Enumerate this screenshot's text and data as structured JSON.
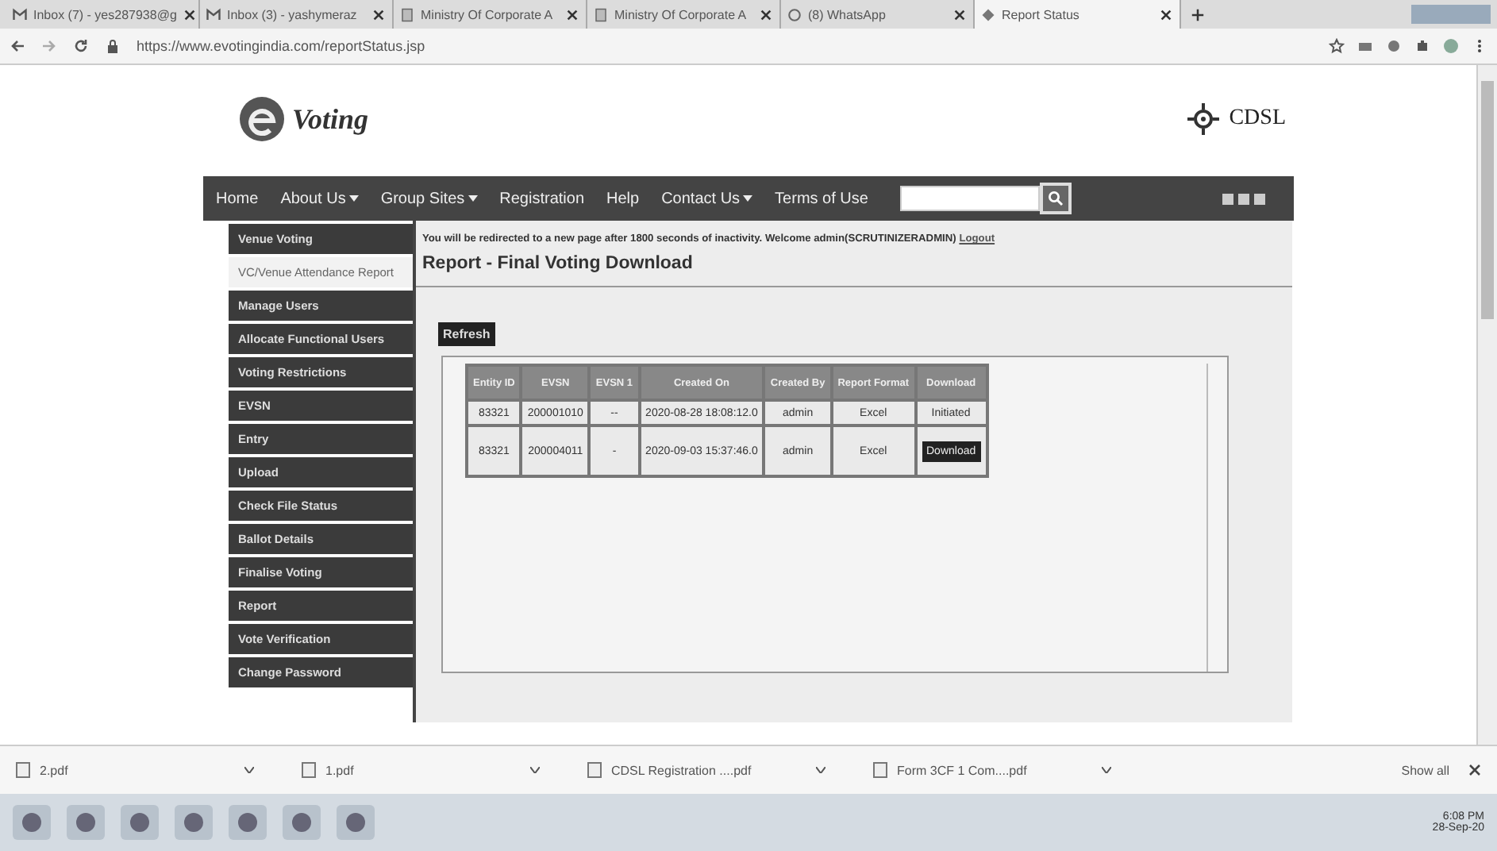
{
  "browser": {
    "tabs": [
      {
        "label": "Inbox (7) - yes287938@g",
        "kind": "mail",
        "selected": false
      },
      {
        "label": "Inbox (3) - yashymeraz",
        "kind": "mail",
        "selected": false
      },
      {
        "label": "Ministry Of Corporate A",
        "kind": "doc",
        "selected": false
      },
      {
        "label": "Ministry Of Corporate A",
        "kind": "doc",
        "selected": false
      },
      {
        "label": "(8) WhatsApp",
        "kind": "chat",
        "selected": false
      },
      {
        "label": "Report Status",
        "kind": "diamond",
        "selected": true
      }
    ],
    "url": "https://www.evotingindia.com/reportStatus.jsp"
  },
  "header": {
    "logo": "Voting",
    "brand": "CDSL"
  },
  "nav": [
    {
      "label": "Home",
      "dropdown": false
    },
    {
      "label": "About Us",
      "dropdown": true
    },
    {
      "label": "Group Sites",
      "dropdown": true
    },
    {
      "label": "Registration",
      "dropdown": false
    },
    {
      "label": "Help",
      "dropdown": false
    },
    {
      "label": "Contact Us",
      "dropdown": true
    },
    {
      "label": "Terms of Use",
      "dropdown": false
    }
  ],
  "sidebar": {
    "items": [
      {
        "label": "Venue Voting",
        "selected": false
      },
      {
        "label": "VC/Venue Attendance Report",
        "selected": true
      },
      {
        "label": "Manage Users",
        "selected": false
      },
      {
        "label": "Allocate Functional Users",
        "selected": false
      },
      {
        "label": "Voting Restrictions",
        "selected": false
      },
      {
        "label": "EVSN",
        "selected": false
      },
      {
        "label": "Entry",
        "selected": false
      },
      {
        "label": "Upload",
        "selected": false
      },
      {
        "label": "Check File Status",
        "selected": false
      },
      {
        "label": "Ballot Details",
        "selected": false
      },
      {
        "label": "Finalise Voting",
        "selected": false
      },
      {
        "label": "Report",
        "selected": false
      },
      {
        "label": "Vote Verification",
        "selected": false
      },
      {
        "label": "Change Password",
        "selected": false
      }
    ]
  },
  "notice": {
    "text": "You will be redirected to a new page after 1800 seconds of inactivity. Welcome admin(SCRUTINIZERADMIN)",
    "link": "Logout"
  },
  "page_title": "Report - Final Voting Download",
  "refresh_button": "Refresh",
  "table": {
    "columns": [
      "Entity ID",
      "EVSN",
      "EVSN 1",
      "Created On",
      "Created By",
      "Report Format",
      "Download"
    ],
    "rows": [
      {
        "cells": [
          "83321",
          "200001010",
          "--",
          "2020-08-28 18:08:12.0",
          "admin",
          "Excel"
        ],
        "download": {
          "kind": "status",
          "label": "Initiated"
        }
      },
      {
        "cells": [
          "83321",
          "200004011",
          "-",
          "2020-09-03 15:37:46.0",
          "admin",
          "Excel"
        ],
        "download": {
          "kind": "button",
          "label": "Download"
        }
      }
    ]
  },
  "downloads": {
    "items": [
      "2.pdf",
      "1.pdf",
      "CDSL Registration ....pdf",
      "Form 3CF 1 Com....pdf"
    ],
    "show_all": "Show all"
  },
  "taskbar": {
    "time": "6:08 PM",
    "date": "28-Sep-20"
  }
}
